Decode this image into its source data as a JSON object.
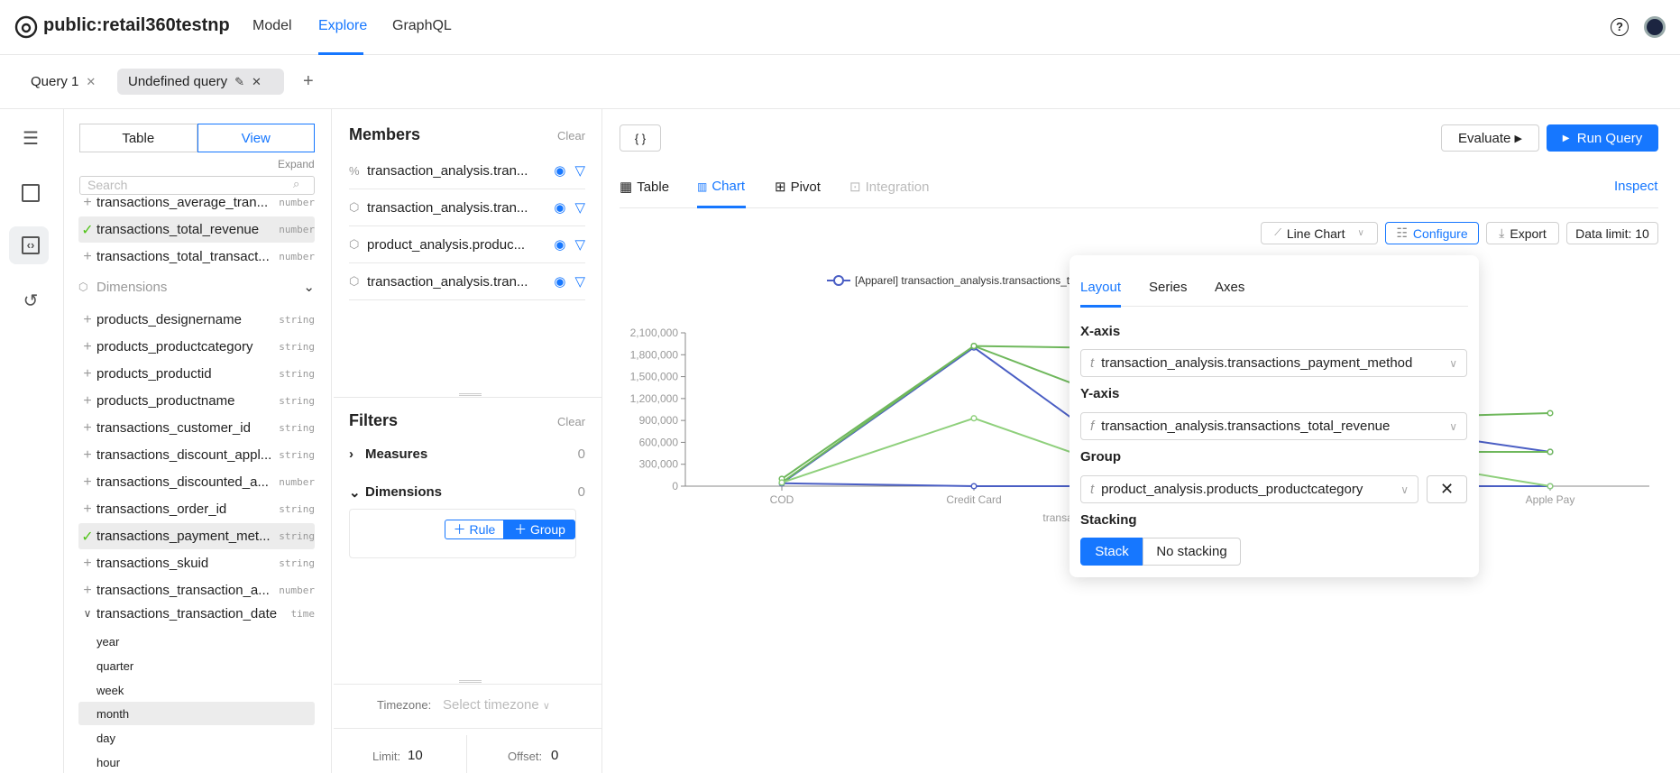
{
  "header": {
    "title": "public:retail360testnp",
    "nav": [
      "Model",
      "Explore",
      "GraphQL"
    ],
    "active_nav": "Explore"
  },
  "query_tabs": [
    {
      "label": "Query 1"
    },
    {
      "label": "Undefined query"
    }
  ],
  "fields": {
    "toggle": [
      "Table",
      "View"
    ],
    "active_toggle": "View",
    "expand": "Expand",
    "search_placeholder": "Search",
    "measures": [
      {
        "name": "transactions_average_tran...",
        "type": "number",
        "selected": false
      },
      {
        "name": "transactions_total_revenue",
        "type": "number",
        "selected": true
      },
      {
        "name": "transactions_total_transact...",
        "type": "number",
        "selected": false
      }
    ],
    "dimensions_label": "Dimensions",
    "dimensions": [
      {
        "name": "products_designername",
        "type": "string",
        "selected": false
      },
      {
        "name": "products_productcategory",
        "type": "string",
        "selected": false
      },
      {
        "name": "products_productid",
        "type": "string",
        "selected": false
      },
      {
        "name": "products_productname",
        "type": "string",
        "selected": false
      },
      {
        "name": "transactions_customer_id",
        "type": "string",
        "selected": false
      },
      {
        "name": "transactions_discount_appl...",
        "type": "string",
        "selected": false
      },
      {
        "name": "transactions_discounted_a...",
        "type": "number",
        "selected": false
      },
      {
        "name": "transactions_order_id",
        "type": "string",
        "selected": false
      },
      {
        "name": "transactions_payment_met...",
        "type": "string",
        "selected": true
      },
      {
        "name": "transactions_skuid",
        "type": "string",
        "selected": false
      },
      {
        "name": "transactions_transaction_a...",
        "type": "number",
        "selected": false
      }
    ],
    "date_field": {
      "name": "transactions_transaction_date",
      "type": "time",
      "granularities": [
        "year",
        "quarter",
        "week",
        "month",
        "day",
        "hour"
      ],
      "selected": "month"
    }
  },
  "members": {
    "title": "Members",
    "clear": "Clear",
    "items": [
      {
        "icon": "measure-icon",
        "name": "transaction_analysis.tran..."
      },
      {
        "icon": "cube-icon",
        "name": "transaction_analysis.tran..."
      },
      {
        "icon": "cube-icon",
        "name": "product_analysis.produc..."
      },
      {
        "icon": "cube-icon",
        "name": "transaction_analysis.tran..."
      }
    ]
  },
  "filters": {
    "title": "Filters",
    "clear": "Clear",
    "measures": "Measures",
    "measures_count": "0",
    "dimensions": "Dimensions",
    "dimensions_count": "0",
    "rule": "Rule",
    "group": "Group"
  },
  "timezone": {
    "label": "Timezone:",
    "placeholder": "Select timezone"
  },
  "limit": {
    "label": "Limit:",
    "value": "10"
  },
  "offset": {
    "label": "Offset:",
    "value": "0"
  },
  "main": {
    "json_button": "{ }",
    "evaluate": "Evaluate",
    "run": "Run Query",
    "tabs": [
      "Table",
      "Chart",
      "Pivot",
      "Integration"
    ],
    "active_tab": "Chart",
    "inspect": "Inspect",
    "toolbar": {
      "chart_type": "Line Chart",
      "configure": "Configure",
      "export": "Export",
      "data_limit": "Data limit: 10"
    }
  },
  "config": {
    "tabs": [
      "Layout",
      "Series",
      "Axes"
    ],
    "active_tab": "Layout",
    "xaxis_label": "X-axis",
    "xaxis_value": "transaction_analysis.transactions_payment_method",
    "xaxis_prefix": "t",
    "yaxis_label": "Y-axis",
    "yaxis_value": "transaction_analysis.transactions_total_revenue",
    "yaxis_prefix": "f",
    "group_label": "Group",
    "group_value": "product_analysis.products_productcategory",
    "group_prefix": "t",
    "stacking_label": "Stacking",
    "stacking_options": [
      "Stack",
      "No stacking"
    ],
    "stacking_selected": "Stack"
  },
  "colors": {
    "accent": "#1677ff",
    "series_blue": "#4a5ec4",
    "series_green": "#7cc46a"
  },
  "chart_data": {
    "type": "line",
    "categories": [
      "COD",
      "Credit Card",
      "",
      "",
      "Apple Pay"
    ],
    "xlabel": "transaction_analysis.transactions_payment_method",
    "ylim": [
      0,
      2100000
    ],
    "yticks": [
      0,
      300000,
      600000,
      900000,
      1200000,
      1500000,
      1800000,
      2100000
    ],
    "legend": [
      "[Apparel] transaction_analysis.transactions_total_revenue"
    ],
    "series": [
      {
        "name": "[Apparel] transaction_analysis.transactions_total_revenue",
        "color": "#4a5ec4",
        "values": [
          40000,
          1900000,
          0,
          850000,
          470000
        ]
      },
      {
        "color": "#4a5ec4",
        "values": [
          40000,
          0,
          0,
          0,
          0
        ]
      },
      {
        "color": "#6fb85c",
        "values": [
          100000,
          1920000,
          1880000,
          930000,
          1000000
        ]
      },
      {
        "color": "#6fb85c",
        "values": [
          50000,
          1920000,
          920000,
          470000,
          470000
        ]
      },
      {
        "color": "#8fd07c",
        "values": [
          50000,
          930000,
          10000,
          435000,
          0
        ]
      }
    ]
  }
}
